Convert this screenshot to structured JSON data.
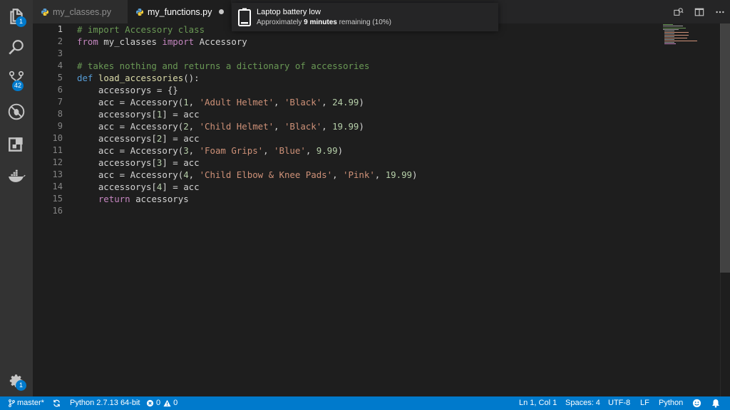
{
  "activity_bar": {
    "explorer_badge": "1",
    "scm_badge": "42",
    "settings_badge": "1"
  },
  "tabs": [
    {
      "label": "my_classes.py",
      "active": false
    },
    {
      "label": "my_functions.py",
      "active": true,
      "dirty": true
    }
  ],
  "notification": {
    "title": "Laptop battery low",
    "body_prefix": "Approximately ",
    "body_bold": "9 minutes",
    "body_suffix": " remaining (10%)"
  },
  "editor": {
    "line_numbers": [
      "1",
      "2",
      "3",
      "4",
      "5",
      "6",
      "7",
      "8",
      "9",
      "10",
      "11",
      "12",
      "13",
      "14",
      "15",
      "16"
    ],
    "lines": [
      [
        {
          "c": "cm",
          "t": "# import Accessory class"
        }
      ],
      [
        {
          "c": "kw2",
          "t": "from"
        },
        {
          "c": "tx",
          "t": " my_classes "
        },
        {
          "c": "kw2",
          "t": "import"
        },
        {
          "c": "tx",
          "t": " Accessory"
        }
      ],
      [],
      [
        {
          "c": "cm",
          "t": "# takes nothing and returns a dictionary of accessories"
        }
      ],
      [
        {
          "c": "kw",
          "t": "def"
        },
        {
          "c": "tx",
          "t": " "
        },
        {
          "c": "fn",
          "t": "load_accessories"
        },
        {
          "c": "tx",
          "t": "():"
        }
      ],
      [
        {
          "c": "tx",
          "t": "    accessorys = {}"
        }
      ],
      [
        {
          "c": "tx",
          "t": "    acc = Accessory("
        },
        {
          "c": "nm",
          "t": "1"
        },
        {
          "c": "tx",
          "t": ", "
        },
        {
          "c": "st",
          "t": "'Adult Helmet'"
        },
        {
          "c": "tx",
          "t": ", "
        },
        {
          "c": "st",
          "t": "'Black'"
        },
        {
          "c": "tx",
          "t": ", "
        },
        {
          "c": "nm",
          "t": "24.99"
        },
        {
          "c": "tx",
          "t": ")"
        }
      ],
      [
        {
          "c": "tx",
          "t": "    accessorys["
        },
        {
          "c": "nm",
          "t": "1"
        },
        {
          "c": "tx",
          "t": "] = acc"
        }
      ],
      [
        {
          "c": "tx",
          "t": "    acc = Accessory("
        },
        {
          "c": "nm",
          "t": "2"
        },
        {
          "c": "tx",
          "t": ", "
        },
        {
          "c": "st",
          "t": "'Child Helmet'"
        },
        {
          "c": "tx",
          "t": ", "
        },
        {
          "c": "st",
          "t": "'Black'"
        },
        {
          "c": "tx",
          "t": ", "
        },
        {
          "c": "nm",
          "t": "19.99"
        },
        {
          "c": "tx",
          "t": ")"
        }
      ],
      [
        {
          "c": "tx",
          "t": "    accessorys["
        },
        {
          "c": "nm",
          "t": "2"
        },
        {
          "c": "tx",
          "t": "] = acc"
        }
      ],
      [
        {
          "c": "tx",
          "t": "    acc = Accessory("
        },
        {
          "c": "nm",
          "t": "3"
        },
        {
          "c": "tx",
          "t": ", "
        },
        {
          "c": "st",
          "t": "'Foam Grips'"
        },
        {
          "c": "tx",
          "t": ", "
        },
        {
          "c": "st",
          "t": "'Blue'"
        },
        {
          "c": "tx",
          "t": ", "
        },
        {
          "c": "nm",
          "t": "9.99"
        },
        {
          "c": "tx",
          "t": ")"
        }
      ],
      [
        {
          "c": "tx",
          "t": "    accessorys["
        },
        {
          "c": "nm",
          "t": "3"
        },
        {
          "c": "tx",
          "t": "] = acc"
        }
      ],
      [
        {
          "c": "tx",
          "t": "    acc = Accessory("
        },
        {
          "c": "nm",
          "t": "4"
        },
        {
          "c": "tx",
          "t": ", "
        },
        {
          "c": "st",
          "t": "'Child Elbow & Knee Pads'"
        },
        {
          "c": "tx",
          "t": ", "
        },
        {
          "c": "st",
          "t": "'Pink'"
        },
        {
          "c": "tx",
          "t": ", "
        },
        {
          "c": "nm",
          "t": "19.99"
        },
        {
          "c": "tx",
          "t": ")"
        }
      ],
      [
        {
          "c": "tx",
          "t": "    accessorys["
        },
        {
          "c": "nm",
          "t": "4"
        },
        {
          "c": "tx",
          "t": "] = acc"
        }
      ],
      [
        {
          "c": "tx",
          "t": "    "
        },
        {
          "c": "kw2",
          "t": "return"
        },
        {
          "c": "tx",
          "t": " accessorys"
        }
      ],
      []
    ]
  },
  "status_bar": {
    "branch": "master*",
    "interpreter": "Python 2.7.13 64-bit",
    "errors": "0",
    "warnings": "0",
    "cursor": "Ln 1, Col 1",
    "spaces": "Spaces: 4",
    "encoding": "UTF-8",
    "eol": "LF",
    "language": "Python"
  },
  "colors": {
    "accent": "#007acc",
    "activity_bar": "#333333",
    "editor_bg": "#1e1e1e"
  }
}
